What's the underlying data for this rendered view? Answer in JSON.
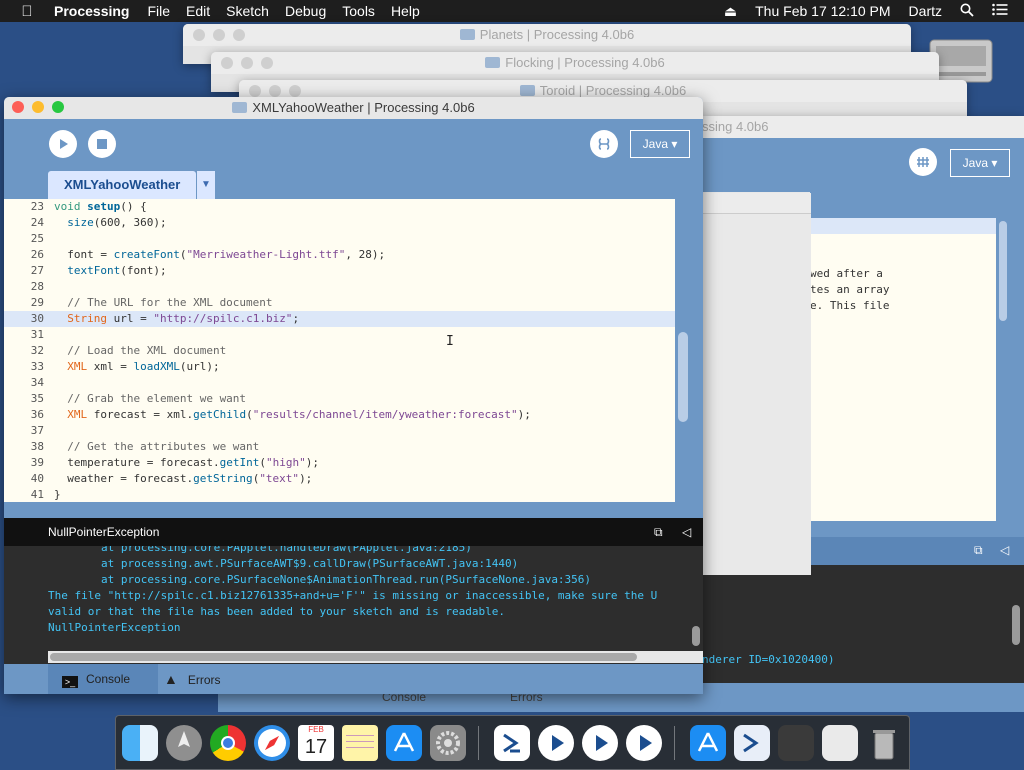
{
  "menubar": {
    "app": "Processing",
    "menus": [
      "File",
      "Edit",
      "Sketch",
      "Debug",
      "Tools",
      "Help"
    ],
    "clock": "Thu Feb 17  12:10 PM",
    "user": "Dartz"
  },
  "windows": {
    "bg1_title": "Planets | Processing 4.0b6",
    "bg2_title": "Flocking | Processing 4.0b6",
    "bg3_title": "Toroid | Processing 4.0b6",
    "bg4_title": "ssing 4.0b6",
    "bg4_mode": "Java",
    "bg4_text": [
      "wed after a",
      "tes an array",
      "e. This file"
    ],
    "bg4_console": "nderer ID=0x1020400)",
    "strip_console": "Console",
    "strip_errors": "Errors"
  },
  "main": {
    "title": "XMLYahooWeather | Processing 4.0b6",
    "mode": "Java",
    "tab": "XMLYahooWeather",
    "code": [
      {
        "n": "23",
        "parts": [
          {
            "c": "k-kw",
            "t": "void "
          },
          {
            "c": "k-fn k-bold",
            "t": "setup"
          },
          {
            "c": "",
            "t": "() {"
          }
        ]
      },
      {
        "n": "24",
        "parts": [
          {
            "c": "",
            "t": "  "
          },
          {
            "c": "k-fn",
            "t": "size"
          },
          {
            "c": "",
            "t": "(600, 360);"
          }
        ]
      },
      {
        "n": "25",
        "parts": []
      },
      {
        "n": "26",
        "parts": [
          {
            "c": "",
            "t": "  font = "
          },
          {
            "c": "k-fn",
            "t": "createFont"
          },
          {
            "c": "",
            "t": "("
          },
          {
            "c": "k-str",
            "t": "\"Merriweather-Light.ttf\""
          },
          {
            "c": "",
            "t": ", 28);"
          }
        ]
      },
      {
        "n": "27",
        "parts": [
          {
            "c": "",
            "t": "  "
          },
          {
            "c": "k-fn",
            "t": "textFont"
          },
          {
            "c": "",
            "t": "(font);"
          }
        ]
      },
      {
        "n": "28",
        "parts": []
      },
      {
        "n": "29",
        "parts": [
          {
            "c": "k-cm",
            "t": "  // The URL for the XML document"
          }
        ]
      },
      {
        "n": "30",
        "hl": true,
        "parts": [
          {
            "c": "",
            "t": "  "
          },
          {
            "c": "k-type",
            "t": "String"
          },
          {
            "c": "",
            "t": " url = "
          },
          {
            "c": "k-str",
            "t": "\"http://spilc.c1.biz\""
          },
          {
            "c": "",
            "t": ";"
          }
        ]
      },
      {
        "n": "31",
        "parts": []
      },
      {
        "n": "32",
        "parts": [
          {
            "c": "k-cm",
            "t": "  // Load the XML document"
          }
        ]
      },
      {
        "n": "33",
        "parts": [
          {
            "c": "",
            "t": "  "
          },
          {
            "c": "k-type",
            "t": "XML"
          },
          {
            "c": "",
            "t": " xml = "
          },
          {
            "c": "k-fn",
            "t": "loadXML"
          },
          {
            "c": "",
            "t": "(url);"
          }
        ]
      },
      {
        "n": "34",
        "parts": []
      },
      {
        "n": "35",
        "parts": [
          {
            "c": "k-cm",
            "t": "  // Grab the element we want"
          }
        ]
      },
      {
        "n": "36",
        "parts": [
          {
            "c": "",
            "t": "  "
          },
          {
            "c": "k-type",
            "t": "XML"
          },
          {
            "c": "",
            "t": " forecast = xml."
          },
          {
            "c": "k-fn",
            "t": "getChild"
          },
          {
            "c": "",
            "t": "("
          },
          {
            "c": "k-str",
            "t": "\"results/channel/item/yweather:forecast\""
          },
          {
            "c": "",
            "t": ");"
          }
        ]
      },
      {
        "n": "37",
        "parts": []
      },
      {
        "n": "38",
        "parts": [
          {
            "c": "k-cm",
            "t": "  // Get the attributes we want"
          }
        ]
      },
      {
        "n": "39",
        "parts": [
          {
            "c": "",
            "t": "  temperature = forecast."
          },
          {
            "c": "k-fn",
            "t": "getInt"
          },
          {
            "c": "",
            "t": "("
          },
          {
            "c": "k-str",
            "t": "\"high\""
          },
          {
            "c": "",
            "t": ");"
          }
        ]
      },
      {
        "n": "40",
        "parts": [
          {
            "c": "",
            "t": "  weather = forecast."
          },
          {
            "c": "k-fn",
            "t": "getString"
          },
          {
            "c": "",
            "t": "("
          },
          {
            "c": "k-str",
            "t": "\"text\""
          },
          {
            "c": "",
            "t": ");"
          }
        ]
      },
      {
        "n": "41",
        "parts": [
          {
            "c": "",
            "t": "}"
          }
        ]
      }
    ],
    "console_header": "NullPointerException",
    "console_lines": [
      "        at processing.core.PApplet.handleDraw(PApplet.java:2185)",
      "        at processing.awt.PSurfaceAWT$9.callDraw(PSurfaceAWT.java:1440)",
      "        at processing.core.PSurfaceNone$AnimationThread.run(PSurfaceNone.java:356)",
      "The file \"http://spilc.c1.biz12761335+and+u='F'\" is missing or inaccessible, make sure the U",
      "valid or that the file has been added to your sketch and is readable.",
      "NullPointerException"
    ],
    "tab_console": "Console",
    "tab_errors": "Errors"
  },
  "dock": {
    "calendar_month": "FEB",
    "calendar_day": "17"
  },
  "colors": {
    "accent": "#6d97c5",
    "desktop": "#2b4f86",
    "console_text": "#43c4f5"
  }
}
